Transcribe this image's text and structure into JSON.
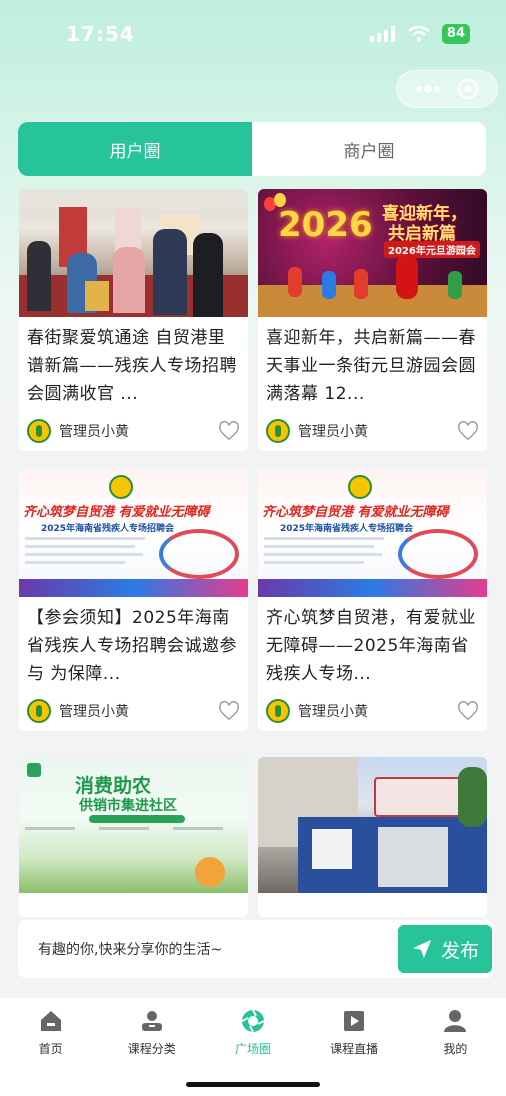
{
  "status": {
    "time": "17:54",
    "battery": "84"
  },
  "tabs": [
    {
      "label": "用户圈"
    },
    {
      "label": "商户圈"
    }
  ],
  "posts": [
    {
      "title": "春街聚爱筑通途 自贸港里谱新篇——残疾人专场招聘会圆满收官 ...",
      "author": "管理员小黄"
    },
    {
      "title": "喜迎新年，共启新篇——春天事业一条街元旦游园会圆满落幕 12...",
      "author": "管理员小黄",
      "image_text": {
        "year": "2026",
        "headline1": "喜迎新年，",
        "headline2": "共启新篇",
        "sub": "2026年元旦游园会"
      }
    },
    {
      "title": "【参会须知】2025年海南省残疾人专场招聘会诚邀参与 为保障...",
      "author": "管理员小黄",
      "image_text": {
        "headline": "齐心筑梦自贸港 有爱就业无障碍",
        "sub": "2025年海南省残疾人专场招聘会"
      }
    },
    {
      "title": "齐心筑梦自贸港，有爱就业无障碍——2025年海南省残疾人专场...",
      "author": "管理员小黄",
      "image_text": {
        "headline": "齐心筑梦自贸港 有爱就业无障碍",
        "sub": "2025年海南省残疾人专场招聘会"
      }
    },
    {
      "title": "",
      "author": "",
      "image_text": {
        "headline1": "消费助农",
        "headline2": "供销市集进社区"
      }
    },
    {
      "title": "",
      "author": ""
    }
  ],
  "publish": {
    "placeholder": "有趣的你,快来分享你的生活~",
    "button": "发布"
  },
  "nav": [
    {
      "label": "首页",
      "icon": "home-icon"
    },
    {
      "label": "课程分类",
      "icon": "category-icon"
    },
    {
      "label": "广场圈",
      "icon": "square-circle-icon"
    },
    {
      "label": "课程直播",
      "icon": "live-play-icon"
    },
    {
      "label": "我的",
      "icon": "profile-icon"
    }
  ],
  "colors": {
    "accent": "#27c39a"
  }
}
